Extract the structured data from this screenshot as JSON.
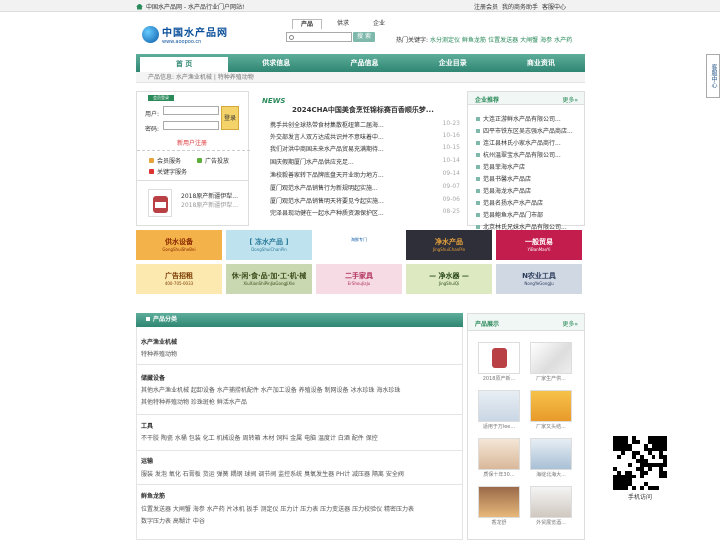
{
  "topbar": {
    "home": "中国水产品网 - 水产品行业门户网站!",
    "links": [
      "注册会员",
      "我的商务助手",
      "客服中心"
    ]
  },
  "logo": {
    "cn": "中国水产品网",
    "en": "www.aoopoo.cn"
  },
  "search": {
    "tabs": [
      "产品",
      "供求",
      "企业"
    ],
    "button": "搜 索",
    "hot_label": "热门关键字:",
    "hot": [
      "水分测定仪",
      "鲜鱼龙筋",
      "位置发送器",
      "大闸蟹",
      "海参",
      "水产药"
    ]
  },
  "nav": [
    "首 页",
    "供求信息",
    "产品信息",
    "企业目录",
    "商业资讯"
  ],
  "crumb": "产品信息: 水产渔业机械 | 特种养殖动物",
  "login": {
    "tag": "会员登录",
    "user": "用户:",
    "pass": "密码:",
    "btn": "登录",
    "reg": "新用户注册",
    "services": [
      "会员服务",
      "广告投放",
      "关键字服务"
    ]
  },
  "cert": {
    "t1": "2018原产新疆伊犁...",
    "t2": "2018原产新疆伊犁..."
  },
  "news": {
    "badge": "NEWS",
    "headline": "2024CHA中国美食烹饪锦标赛百香顺乐梦...",
    "items": [
      {
        "t": "携手共创全球热带食材集散枢纽第二届海...",
        "d": "10-23"
      },
      {
        "t": "外交部发言人双方达成共识并不意味着中...",
        "d": "10-16"
      },
      {
        "t": "我们对洪中商国未来水产品贸易充满期待...",
        "d": "10-15"
      },
      {
        "t": "国庆假期厦门水产品供应充足...",
        "d": "10-14"
      },
      {
        "t": "渔校毅善家转下品牌底盘天开业助力地方...",
        "d": "09-14"
      },
      {
        "t": "厦门观范水产品销售行为新规明起实施...",
        "d": "09-07"
      },
      {
        "t": "厦门观范水产品销售明天将要见今起实施...",
        "d": "09-06"
      },
      {
        "t": "完泽县现动健在一起水产种质资源保护区...",
        "d": "08-25"
      }
    ]
  },
  "rec": {
    "title": "企业推荐",
    "more": "更多»",
    "items": [
      "大连正游鲜水产品有限公司...",
      "四平市铁东区吴志强水产品商店...",
      "连江县林氏小家水产品商行...",
      "杭州温翠宝水产品有限公司...",
      "范县菲海水产店",
      "范县书馨水产品店",
      "范县海龙水产品店",
      "范县名扬水产水产品店",
      "范县鲍鱼水产品门市部",
      "北京林氏兄妹水产品有限公司..."
    ]
  },
  "ads": [
    {
      "label": "供水设备",
      "sub": "GongShuiSheBei",
      "bg": "#f4b24a",
      "fg": "#8a2a00"
    },
    {
      "label": "[ 冻水产品 ]",
      "sub": "DongShuiChanPin",
      "bg": "#bfe3ee",
      "fg": "#2a7a9a"
    },
    {
      "label": "",
      "sub": "海鲜专门",
      "bg": "#ffffff",
      "fg": "#0a5aa8"
    },
    {
      "label": "净水产品",
      "sub": "JingShuiChanPin",
      "bg": "#2f2f3a",
      "fg": "#e8a33a"
    },
    {
      "label": "一般贸易",
      "sub": "YiBanMaoYi",
      "bg": "#c31d4e",
      "fg": "#fff"
    },
    {
      "label": "广告招租",
      "sub": "400-705-0033",
      "bg": "#fbe9b0",
      "fg": "#7a3a00"
    },
    {
      "label": "休·闲·食·品·加·工·机·械",
      "sub": "XiuXianShiPinJiaGongJiXie",
      "bg": "#c9d8b0",
      "fg": "#3a4a1a"
    },
    {
      "label": "二手家具",
      "sub": "ErShouJiaJu",
      "bg": "#f6dbe5",
      "fg": "#b0305a"
    },
    {
      "label": "— 净水器 —",
      "sub": "JingShuiQi",
      "bg": "#dde9c0",
      "fg": "#2a4a1a"
    },
    {
      "label": "N农业工具",
      "sub": "NongYeGongJu",
      "bg": "#d0d8e4",
      "fg": "#2a3a5a"
    }
  ],
  "cats": {
    "title": "产品分类",
    "sections": [
      {
        "title": "水产渔业机械",
        "lines": [
          "特种养殖动物"
        ]
      },
      {
        "title": "储藏设备",
        "lines": [
          "其他水产渔业机械  起卸设备  水产捕捞机配件  水产加工设备  养殖设备  制网设备  冰水珍珠  海水珍珠",
          "其他特种养殖动物  珍珠斑枪  鲜活水产品"
        ]
      },
      {
        "title": "工具",
        "lines": [
          "不干胶  陶瓷  水桶  包装  化工  机械设备  周转箱  木材  饲料  金属  电脑  温度计  白酒  配件  保控"
        ]
      },
      {
        "title": "运输",
        "lines": [
          "服装  发泡  氧化  石膏板  货运  弹簧  耦钢  球阀  调节阀  监控系统  臭氧发生器  PH计  减压器  隔离  安全阀"
        ]
      },
      {
        "title": "鲜鱼龙筋",
        "lines": [
          "位置发送器  大闸蟹  海参  水产药  片冰机  扳手  测定仪  压力计  压力表  压力变送器  压力校验仪  精密压力表",
          "数字压力表  高糊计  中谷"
        ]
      }
    ]
  },
  "show": {
    "title": "产品展示",
    "more": "更多»",
    "items": [
      "2018原产新...",
      "厂家生产供...",
      "适用于万lee...",
      "厂家又头结...",
      "质保十年30...",
      "海绽北海大...",
      "香龙舒",
      "外贸展览酒..."
    ]
  },
  "qr": {
    "caption": "手机访问"
  },
  "side": "客服中心"
}
